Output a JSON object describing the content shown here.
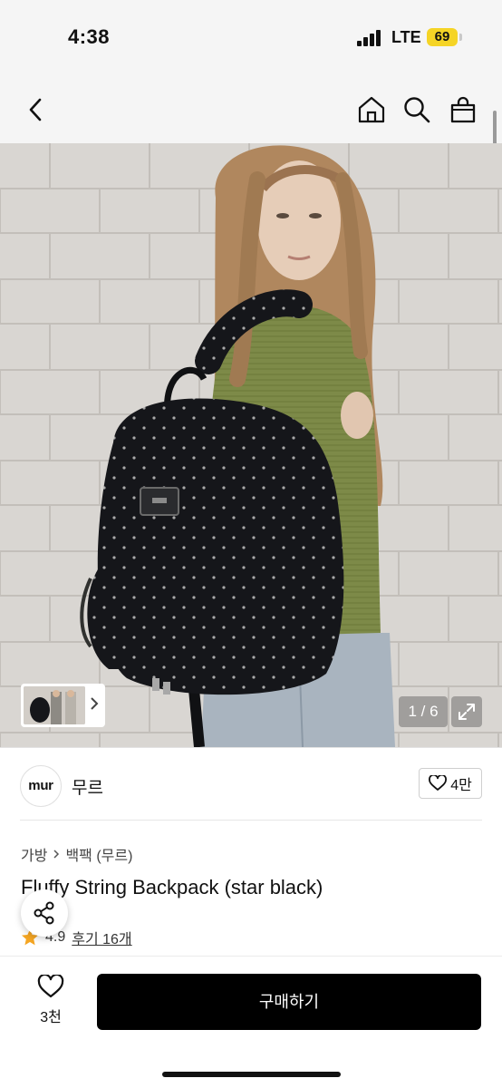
{
  "status_bar": {
    "time": "4:38",
    "network": "LTE",
    "battery": "69"
  },
  "nav": {
    "icons": [
      "chevron-left-icon",
      "home-icon",
      "search-icon",
      "shopping-bag-icon"
    ]
  },
  "gallery": {
    "page": "1 / 6"
  },
  "brand": {
    "logo_text": "mur",
    "name": "무르",
    "likes": "4만"
  },
  "product": {
    "category": "가방",
    "subcategory": "백팩 (무르)",
    "title": "Fluffy String Backpack (star black)",
    "rating": "4.9",
    "reviews": "후기 16개"
  },
  "bottom_bar": {
    "like_count": "3천",
    "buy_label": "구매하기"
  },
  "colors": {
    "accent": "#000000",
    "star": "#f5a623",
    "battery": "#f5d426"
  }
}
